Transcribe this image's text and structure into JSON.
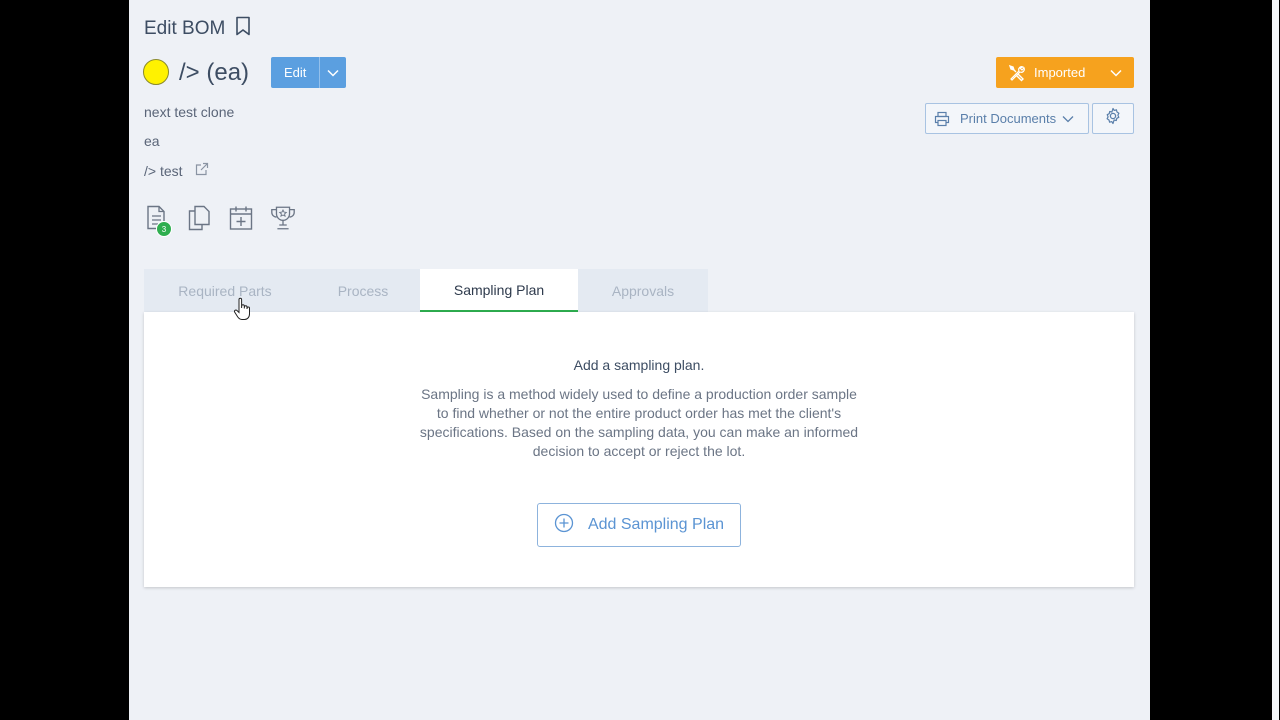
{
  "page": {
    "title": "Edit BOM",
    "bom_name": "/> (ea)",
    "status_color": "#fff200"
  },
  "header": {
    "edit_label": "Edit",
    "status_label": "Imported",
    "print_label": "Print Documents"
  },
  "info": {
    "description": "next test clone",
    "unit": "ea",
    "link_text": "/> test"
  },
  "actions": {
    "document_badge": "3",
    "icons": [
      "document-icon",
      "copy-icon",
      "calendar-add-icon",
      "trophy-icon"
    ]
  },
  "tabs": [
    {
      "label": "Required Parts"
    },
    {
      "label": "Process"
    },
    {
      "label": "Sampling Plan"
    },
    {
      "label": "Approvals"
    }
  ],
  "active_tab": "Sampling Plan",
  "sampling": {
    "title": "Add a sampling plan.",
    "description": "Sampling is a method widely used to define a production order sample to find whether or not the entire product order has met the client's specifications. Based on the sampling data, you can make an informed decision to accept or reject the lot.",
    "add_button": "Add Sampling Plan"
  },
  "colors": {
    "primary": "#5b9fe0",
    "warning": "#f6a21e",
    "success": "#2eae4f"
  }
}
